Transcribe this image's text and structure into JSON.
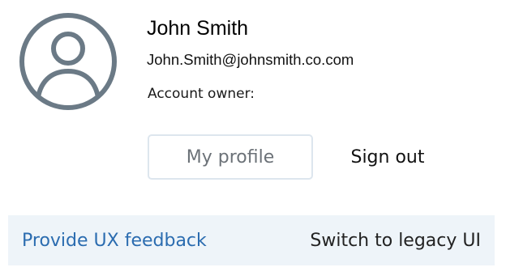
{
  "user": {
    "avatar_icon": "user-avatar-icon",
    "name": "John Smith",
    "email": "John.Smith@johnsmith.co.com",
    "owner_label": "Account owner:",
    "owner_value": ""
  },
  "actions": {
    "profile_label": "My profile",
    "signout_label": "Sign out"
  },
  "footer": {
    "feedback_label": "Provide UX feedback",
    "legacy_label": "Switch to legacy UI"
  },
  "colors": {
    "avatar": "#6b7a86",
    "link": "#2b6cb0",
    "footer_bg": "#eef4f9",
    "button_border": "#dde6ee",
    "button_text": "#6c7278"
  }
}
